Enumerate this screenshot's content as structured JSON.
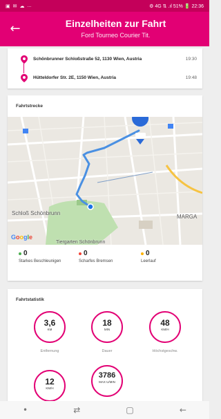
{
  "status_bar": {
    "icons_left": [
      "gallery-icon",
      "sms-icon",
      "cloud-icon"
    ],
    "more": "...",
    "right": "⚙ 4G ⇅ .ıl 51% 🔋 22:36"
  },
  "header": {
    "back_icon": "arrow-left-icon",
    "title": "Einzelheiten zur Fahrt",
    "subtitle": "Ford Tourneo Courier Tit."
  },
  "trip": {
    "start": {
      "address": "Schönbrunner Schloßstraße 52, 1130 Wien, Austria",
      "time": "19:30"
    },
    "end": {
      "address": "Hütteldorfer Str. 2E, 1150 Wien, Austria",
      "time": "19:48"
    }
  },
  "route": {
    "section_title": "Fahrtstrecke",
    "map": {
      "labels": {
        "castle": "Schloß Schönbrunn",
        "district": "MARGA",
        "park": "Tiergarten Schönbrunn"
      },
      "logo_letters": [
        "G",
        "o",
        "o",
        "g",
        "l",
        "e"
      ]
    },
    "events": [
      {
        "count": "0",
        "label": "Starkes Beschleunigen",
        "color": "#4caf50"
      },
      {
        "count": "0",
        "label": "Scharfes Bremsen",
        "color": "#f44336"
      },
      {
        "count": "0",
        "label": "Leerlauf",
        "color": "#ffb300"
      }
    ]
  },
  "stats": {
    "section_title": "Fahrtstatistik",
    "items": [
      {
        "value": "3,6",
        "unit": "KM",
        "caption": "Entfernung"
      },
      {
        "value": "18",
        "unit": "MIN",
        "caption": "Dauer"
      },
      {
        "value": "48",
        "unit": "KM/H",
        "caption": "Höchstgeschw."
      },
      {
        "value": "12",
        "unit": "KM/H",
        "caption": ""
      },
      {
        "value": "3786",
        "unit": "MAX U/MIN",
        "caption": ""
      }
    ]
  },
  "navbar": {
    "dot": "•",
    "recent": "⇄",
    "home": "▢",
    "back": "←"
  },
  "colors": {
    "brand": "#e20074",
    "status": "#c4005a",
    "route": "#4a90e2"
  }
}
